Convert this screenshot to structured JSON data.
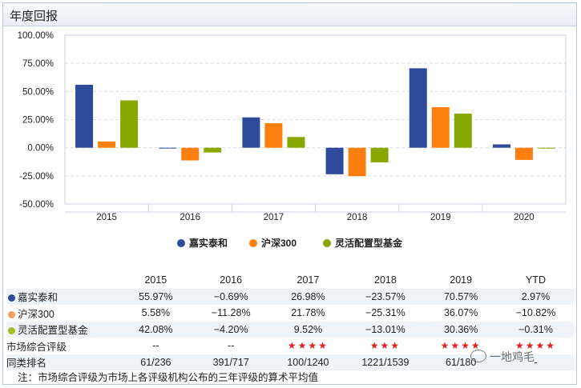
{
  "panel": {
    "title": "年度回报"
  },
  "chart_data": {
    "type": "bar",
    "categories": [
      "2015",
      "2016",
      "2017",
      "2018",
      "2019",
      "2020"
    ],
    "series": [
      {
        "name": "嘉实泰和",
        "color": "#2e4a9a",
        "values": [
          55.97,
          -0.69,
          26.98,
          -23.57,
          70.57,
          2.97
        ]
      },
      {
        "name": "沪深300",
        "color": "#ff7f0e",
        "values": [
          5.58,
          -11.28,
          21.78,
          -25.31,
          36.07,
          -10.82
        ]
      },
      {
        "name": "灵活配置型基金",
        "color": "#88a800",
        "values": [
          42.08,
          -4.2,
          9.52,
          -13.01,
          30.36,
          -0.31
        ]
      }
    ],
    "ylim": [
      -50,
      100
    ],
    "yticks": [
      "100.00%",
      "75.00%",
      "50.00%",
      "25.00%",
      "0.00%",
      "-25.00%",
      "-50.00%"
    ],
    "grid": true,
    "legend": "bottom"
  },
  "table": {
    "headers": [
      "",
      "2015",
      "2016",
      "2017",
      "2018",
      "2019",
      "YTD"
    ],
    "rows": [
      {
        "label": "嘉实泰和",
        "dot": "#2e4a9a",
        "cells": [
          "55.97%",
          "−0.69%",
          "26.98%",
          "−23.57%",
          "70.57%",
          "2.97%"
        ]
      },
      {
        "label": "沪深300",
        "dot": "#f0a060",
        "cells": [
          "5.58%",
          "−11.28%",
          "21.78%",
          "−25.31%",
          "36.07%",
          "−10.82%"
        ]
      },
      {
        "label": "灵活配置型基金",
        "dot": "#a0c020",
        "cells": [
          "42.08%",
          "−4.20%",
          "9.52%",
          "−13.01%",
          "30.36%",
          "−0.31%"
        ]
      },
      {
        "label": "市场综合评级",
        "dot": "",
        "cells": [
          "--",
          "--",
          "★★★★",
          "★★★",
          "★★★★",
          "★★★★"
        ]
      },
      {
        "label": "同类排名",
        "dot": "",
        "cells": [
          "61/236",
          "391/717",
          "100/1240",
          "1221/1539",
          "61/180",
          "-"
        ]
      }
    ]
  },
  "note": "注：市场综合评级为市场上各评级机构公布的三年评级的算术平均值",
  "watermark": "一地鸡毛"
}
